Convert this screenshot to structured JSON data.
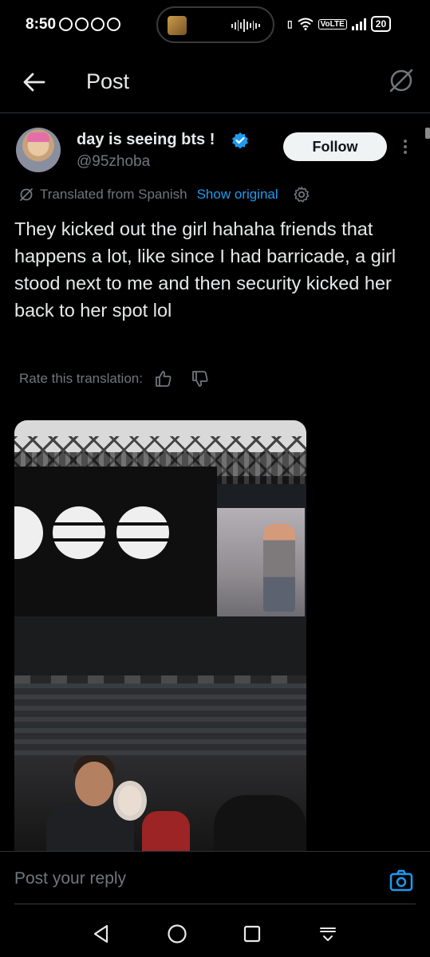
{
  "status_bar": {
    "time": "8:50",
    "network_badge": "VoLTE",
    "battery": "20"
  },
  "header": {
    "title": "Post"
  },
  "post": {
    "author_name": "day is seeing bts !",
    "author_handle": "@95zhoba",
    "follow_label": "Follow",
    "translated_label": "Translated from Spanish",
    "show_original_label": "Show original",
    "text": "They kicked out the girl hahaha friends that happens a lot, like since I had barricade, a girl stood next to me and then security kicked her back to her spot lol",
    "rate_translation_label": "Rate this translation:"
  },
  "reply": {
    "placeholder": "Post your reply"
  },
  "colors": {
    "background": "#000000",
    "text_primary": "#e7e9ea",
    "text_secondary": "#71767b",
    "accent": "#1d9bf0",
    "follow_button_bg": "#eff3f4",
    "divider": "#2f3336"
  },
  "icons": {
    "back": "arrow-left-icon",
    "grok": "grok-slash-icon",
    "verified": "verified-badge-icon",
    "more": "vertical-dots-icon",
    "settings": "gear-icon",
    "thumbs_up": "thumbs-up-icon",
    "thumbs_down": "thumbs-down-icon",
    "camera": "camera-icon",
    "nav_back": "triangle-back-icon",
    "nav_home": "circle-home-icon",
    "nav_recents": "square-recents-icon",
    "nav_hide": "keyboard-hide-icon"
  }
}
